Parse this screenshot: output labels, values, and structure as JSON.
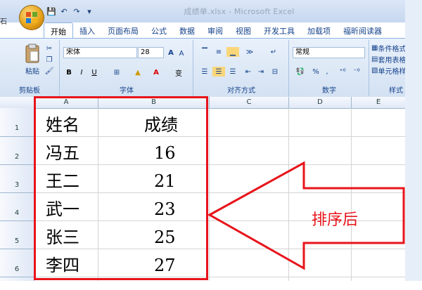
{
  "window": {
    "title": "成绩单.xlsx - Microsoft Excel",
    "left_fragment": "石"
  },
  "quick_access": {
    "save": "💾",
    "undo": "↶",
    "redo": "↷",
    "more": "▾"
  },
  "tabs": [
    "开始",
    "插入",
    "页面布局",
    "公式",
    "数据",
    "审阅",
    "视图",
    "开发工具",
    "加载项",
    "福昕阅读器"
  ],
  "ribbon": {
    "clipboard": {
      "paste": "粘贴",
      "label": "剪贴板"
    },
    "font": {
      "name": "宋体",
      "size": "28",
      "bold": "B",
      "italic": "I",
      "underline": "U",
      "grow": "A",
      "shrink": "A",
      "wen": "变",
      "label": "字体"
    },
    "alignment": {
      "label": "对齐方式"
    },
    "number": {
      "format": "常规",
      "percent": "%",
      "comma": ",",
      "label": "数字"
    },
    "styles": {
      "cond": "条件格式",
      "table": "套用表格",
      "cell": "单元格样",
      "label": "样式"
    }
  },
  "sheet": {
    "columns": [
      "A",
      "B",
      "C",
      "D",
      "E"
    ],
    "rows": [
      "1",
      "2",
      "3",
      "4",
      "5",
      "6"
    ],
    "cells": [
      [
        "姓名",
        "成绩"
      ],
      [
        "冯五",
        "16"
      ],
      [
        "王二",
        "21"
      ],
      [
        "武一",
        "23"
      ],
      [
        "张三",
        "25"
      ],
      [
        "李四",
        "27"
      ]
    ]
  },
  "annotation": {
    "text": "排序后",
    "color": "#e8141b"
  }
}
